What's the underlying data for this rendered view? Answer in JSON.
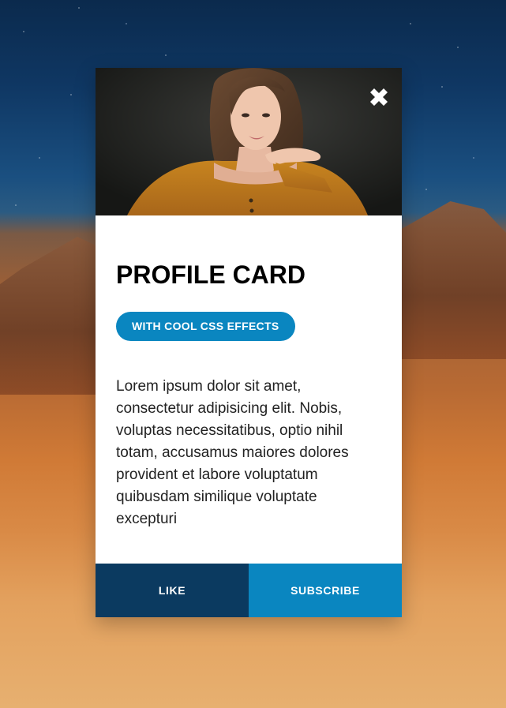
{
  "card": {
    "title": "PROFILE CARD",
    "badge": "WITH COOL CSS EFFECTS",
    "description": "Lorem ipsum dolor sit amet, consectetur adipisicing elit. Nobis, voluptas necessitatibus, optio nihil totam, accusamus maiores dolores provident et labore voluptatum quibusdam similique voluptate excepturi",
    "close_icon": "close-icon",
    "actions": {
      "like_label": "LIKE",
      "subscribe_label": "SUBSCRIBE"
    }
  },
  "colors": {
    "accent": "#0a86c0",
    "like": "#0b3a60",
    "subscribe": "#0a86c0"
  }
}
